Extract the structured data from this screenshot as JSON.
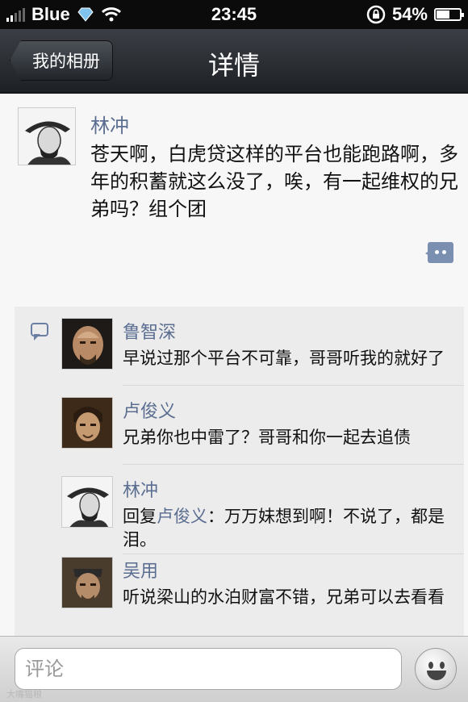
{
  "status_bar": {
    "carrier": "Blue",
    "time": "23:45",
    "battery": "54%",
    "battery_level": 0.54
  },
  "nav": {
    "back_label": "我的相册",
    "title": "详情"
  },
  "post": {
    "author": "林冲",
    "text": "苍天啊，白虎贷这样的平台也能跑路啊，多年的积蓄就这么没了，唉，有一起维权的兄弟吗？组个团"
  },
  "comments": [
    {
      "author": "鲁智深",
      "text": "早说过那个平台不可靠，哥哥听我的就好了"
    },
    {
      "author": "卢俊义",
      "text": "兄弟你也中雷了？哥哥和你一起去追债"
    },
    {
      "author": "林冲",
      "reply_prefix": "回复",
      "reply_to": "卢俊义",
      "text": "：万万妹想到啊！不说了，都是泪。"
    },
    {
      "author": "吴用",
      "text": "听说梁山的水泊财富不错，兄弟可以去看看"
    }
  ],
  "input": {
    "placeholder": "评论"
  },
  "watermark": "大嘴猫粮",
  "colors": {
    "link_blue": "#5b6e91",
    "nav_dark": "#1d2024",
    "comment_bg": "#ececec"
  },
  "icons": [
    "signal-icon",
    "wifi-icon",
    "rotation-lock-icon",
    "battery-icon",
    "comment-bubble-icon",
    "emoji-icon"
  ]
}
